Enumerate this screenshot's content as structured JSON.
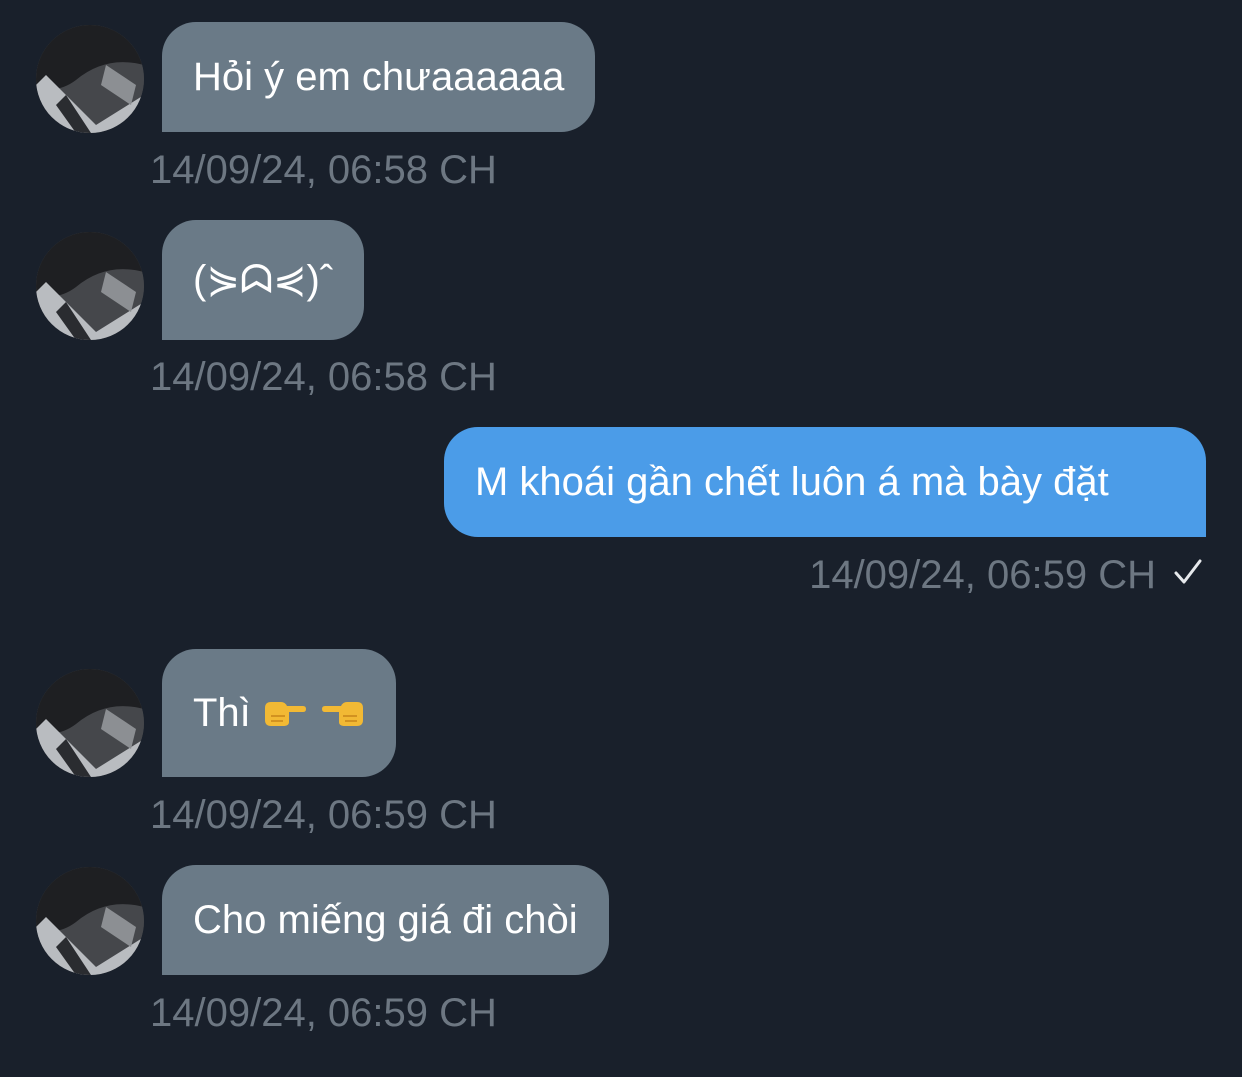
{
  "messages": [
    {
      "direction": "incoming",
      "text": "Hỏi ý em chưaaaaaa",
      "time": "14/09/24, 06:58 CH"
    },
    {
      "direction": "incoming",
      "text": "(⋟ᗣ⋞)ˆ",
      "time": "14/09/24, 06:58 CH"
    },
    {
      "direction": "outgoing",
      "text": "M khoái gần chết luôn á mà bày đặt",
      "time": "14/09/24, 06:59 CH",
      "status_icon": "checkmark-icon"
    },
    {
      "direction": "incoming",
      "text": "Thì",
      "emoji_icons": [
        "pointing-right-hand-icon",
        "pointing-left-hand-icon"
      ],
      "time": "14/09/24, 06:59 CH"
    },
    {
      "direction": "incoming",
      "text": "Cho miếng giá đi chòi",
      "time": "14/09/24, 06:59 CH"
    }
  ],
  "colors": {
    "background": "#19202b",
    "incoming_bubble": "#6a7a87",
    "outgoing_bubble": "#4b9ce8",
    "timestamp": "#6d7782"
  }
}
